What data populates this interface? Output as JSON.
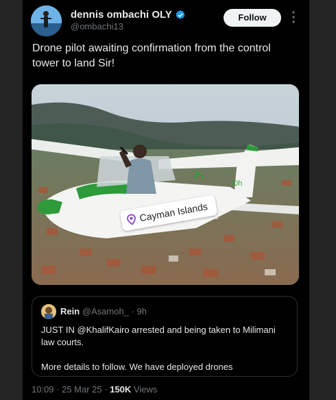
{
  "post": {
    "author": {
      "display_name": "dennis ombachi OLY",
      "handle": "@ombachi13",
      "verified": true
    },
    "follow_label": "Follow",
    "more_icon": "more-vertical-icon",
    "text": "Drone pilot awaiting confirmation from the control tower to land Sir!",
    "image": {
      "location_label": "Cayman Islands",
      "location_icon": "location-pin-icon"
    },
    "quote": {
      "author_name": "Rein",
      "handle": "@Asamoh_",
      "separator": " · ",
      "time": "9h",
      "lines": [
        "JUST  IN @KhalifKairo arrested and being taken to Milimani law courts.",
        "More details to follow. We have deployed drones"
      ]
    },
    "footer": {
      "time": "10:09",
      "date": "25 Mar 25",
      "views_count": "150K",
      "views_label": "Views"
    }
  },
  "colors": {
    "background": "#000000",
    "follow_bg": "#eff3f4",
    "verified": "#1d9bf0",
    "muted": "#71767b",
    "plane_accent": "#2e9a3a"
  }
}
